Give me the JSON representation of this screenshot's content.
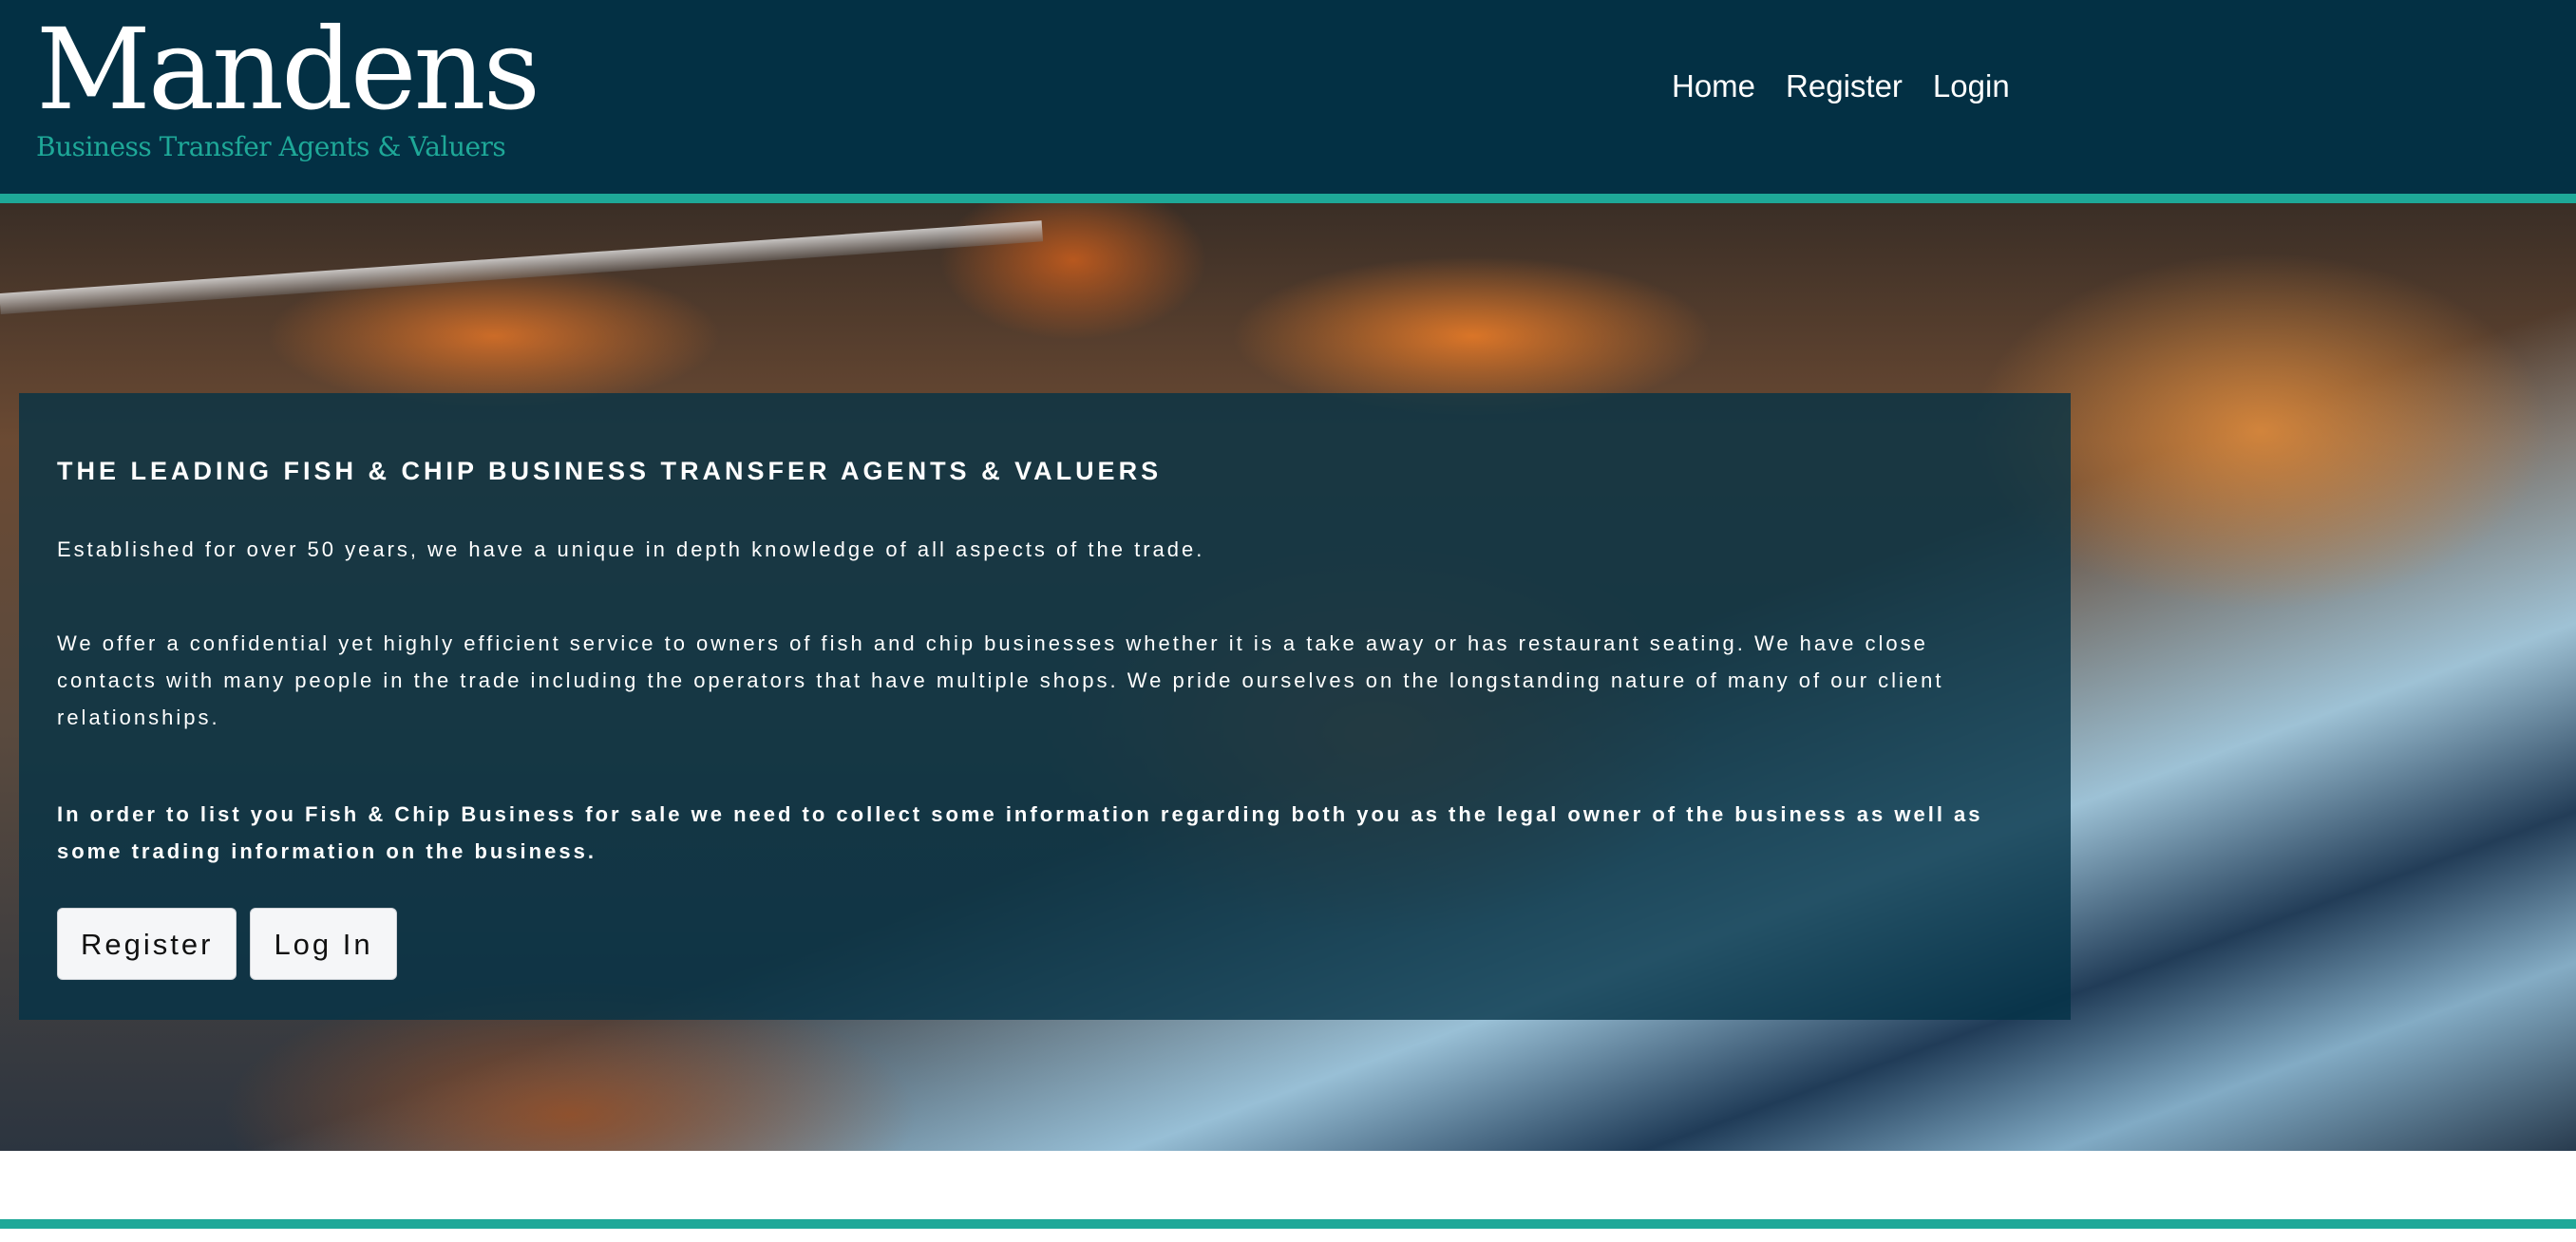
{
  "brand": {
    "name": "Mandens",
    "tagline": "Business Transfer Agents & Valuers"
  },
  "nav": {
    "items": [
      "Home",
      "Register",
      "Login"
    ]
  },
  "hero": {
    "title": "THE LEADING FISH & CHIP BUSINESS TRANSFER AGENTS & VALUERS",
    "paragraphs": [
      "Established for over 50 years, we have a unique in depth knowledge of all aspects of the trade.",
      "We offer a confidential yet highly efficient service to owners of fish and chip businesses whether it is a take away or has restaurant seating. We have close contacts with many people in the trade including the operators that have multiple shops. We pride ourselves on the longstanding nature of many of our client relationships.",
      "In order to list you Fish & Chip Business for sale we need to collect some information regarding both you as the legal owner of the business as well as some trading information on the business."
    ],
    "buttons": {
      "register": "Register",
      "login": "Log In"
    }
  },
  "colors": {
    "header_bg": "#033044",
    "accent": "#1ea898",
    "panel_bg": "rgba(3,50,70,0.78)",
    "button_bg": "#f5f6f8"
  }
}
